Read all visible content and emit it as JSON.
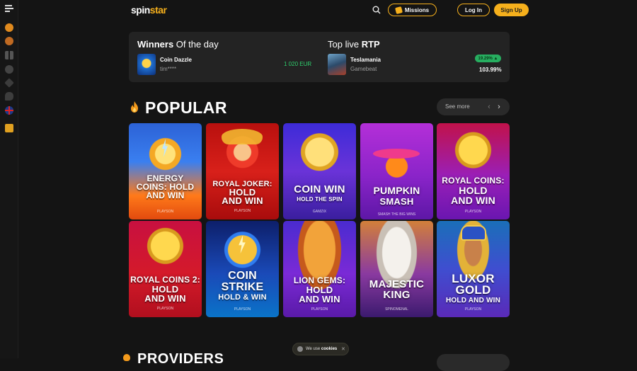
{
  "header": {
    "logo_text_a": "spin",
    "logo_text_b": "star",
    "missions_label": "Missions",
    "login_label": "Log In",
    "signup_label": "Sign Up"
  },
  "winners": {
    "title_bold": "Winners",
    "title_rest": " Of the day",
    "game": "Coin Dazzle",
    "user": "tim****",
    "amount": "1 020 EUR"
  },
  "rtp": {
    "title_rest": "Top live ",
    "title_bold": "RTP",
    "game": "Teslamania",
    "provider": "Gamebeat",
    "badge": "19.29% ▲",
    "value": "103.99%"
  },
  "popular": {
    "title": "POPULAR",
    "see_more": "See more",
    "prev": "‹",
    "next": "›"
  },
  "games": [
    {
      "l1": "ENERGY",
      "l2": "COINS: HOLD",
      "l3": "AND WIN",
      "prov": "PLAYSON"
    },
    {
      "l1": "ROYAL JOKER:",
      "l2": "HOLD",
      "l3": "AND WIN",
      "prov": "PLAYSON"
    },
    {
      "l1": "COIN WIN",
      "l2": "HOLD THE SPIN",
      "l3": "",
      "prov": "GAMZIX"
    },
    {
      "l1": "PUMPKIN",
      "l2": "SMASH",
      "l3": "",
      "prov": "SMASH THE BIG WINS"
    },
    {
      "l1": "ROYAL COINS:",
      "l2": "HOLD",
      "l3": "AND WIN",
      "prov": "PLAYSON"
    },
    {
      "l1": "ROYAL COINS 2:",
      "l2": "HOLD",
      "l3": "AND WIN",
      "prov": "PLAYSON"
    },
    {
      "l1": "COIN",
      "l2": "STRIKE",
      "l3": "HOLD & WIN",
      "prov": "PLAYSON"
    },
    {
      "l1": "LION GEMS:",
      "l2": "HOLD",
      "l3": "AND WIN",
      "prov": "PLAYSON"
    },
    {
      "l1": "MAJESTIC",
      "l2": "KING",
      "l3": "",
      "prov": "SPINOMENAL"
    },
    {
      "l1": "LUXOR",
      "l2": "GOLD",
      "l3": "HOLD AND WIN",
      "prov": "PLAYSON"
    }
  ],
  "cookie": {
    "prefix": "We use ",
    "bold": "cookies",
    "close": "✕"
  },
  "providers_title": "PROVIDERS",
  "colors": {
    "accent": "#f6b01c",
    "win_green": "#2fd06e",
    "panel": "#232323",
    "bg": "#141414"
  }
}
